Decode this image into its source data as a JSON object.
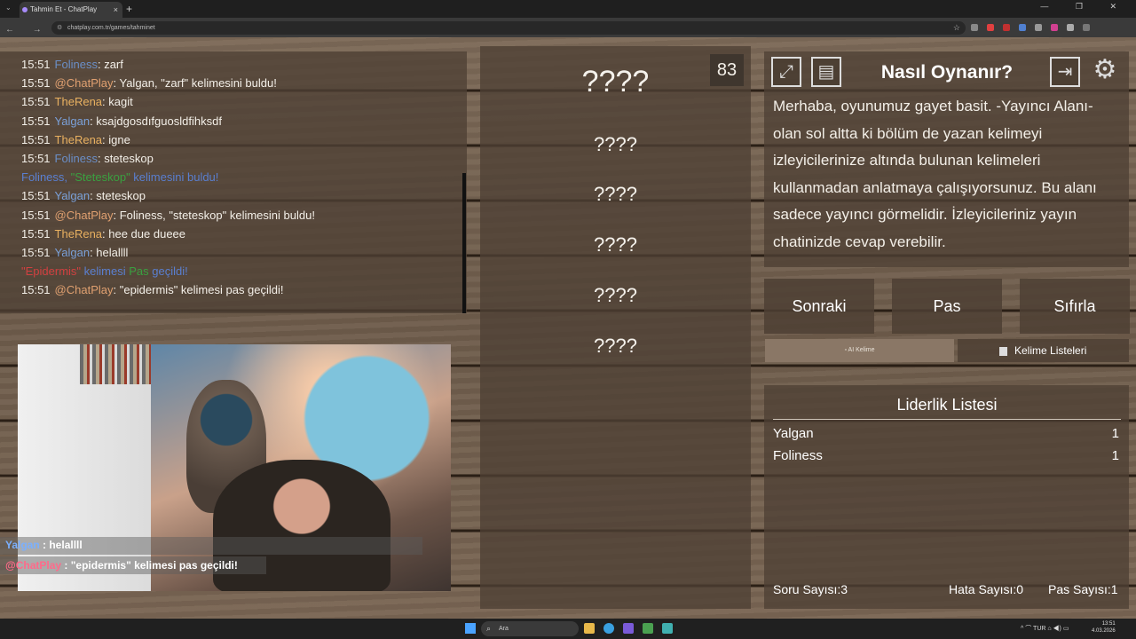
{
  "browser": {
    "tab_title": "Tahmin Et - ChatPlay",
    "tab_close": "×",
    "new_tab": "+",
    "url": "chatplay.com.tr/games/tahminet",
    "nav": "← → ⟳ ⓘ",
    "window_controls": "— ❐ ✕"
  },
  "chat": {
    "messages": [
      {
        "time": "15:51",
        "user": "Foliness",
        "user_color": "#6b8fc7",
        "text": ": zarf"
      },
      {
        "time": "15:51",
        "user": "@ChatPlay",
        "user_color": "#e0a070",
        "text": ": Yalgan, \"zarf\" kelimesini buldu!"
      },
      {
        "time": "15:51",
        "user": "TheRena",
        "user_color": "#e8b060",
        "text": ": kagit"
      },
      {
        "time": "15:51",
        "user": "Yalgan",
        "user_color": "#7aa0d8",
        "text": ": ksajdgosdıfguosldfihksdf"
      },
      {
        "time": "15:51",
        "user": "TheRena",
        "user_color": "#e8b060",
        "text": ": igne"
      },
      {
        "time": "15:51",
        "user": "Foliness",
        "user_color": "#6b8fc7",
        "text": ": steteskop"
      },
      {
        "time": "",
        "user": "Foliness, ",
        "user_color": "#5a7fd0",
        "text": ""
      },
      {
        "time": "15:51",
        "user": "Yalgan",
        "user_color": "#7aa0d8",
        "text": ": steteskop"
      },
      {
        "time": "15:51",
        "user": "@ChatPlay",
        "user_color": "#e0a070",
        "text": ": Foliness, \"steteskop\" kelimesini buldu!"
      },
      {
        "time": "15:51",
        "user": "TheRena",
        "user_color": "#e8b060",
        "text": ": hee due dueee"
      },
      {
        "time": "15:51",
        "user": "Yalgan",
        "user_color": "#7aa0d8",
        "text": ": helallll"
      },
      {
        "time": "",
        "user": "",
        "user_color": "#d04040",
        "text": ""
      },
      {
        "time": "15:51",
        "user": "@ChatPlay",
        "user_color": "#e0a070",
        "text": ": \"epidermis\" kelimesi pas geçildi!"
      }
    ],
    "found_line": {
      "who": "Foliness, ",
      "word": "\"Steteskop\"",
      "rest": " kelimesini buldu!"
    },
    "pass_line": {
      "word": "\"Epidermis\"",
      "mid": " kelimesi ",
      "pas": "Pas",
      "rest": " geçildi!"
    }
  },
  "webcam_overlay": {
    "line1_user": "Yalgan",
    "line1_text": " : helallll",
    "line2_user": "@ChatPlay",
    "line2_text": " : \"epidermis\" kelimesi pas geçildi!"
  },
  "game": {
    "timer": "83",
    "words": [
      "????",
      "????",
      "????",
      "????",
      "????",
      "????"
    ]
  },
  "howto": {
    "title": "Nasıl Oynanır?",
    "text": "Merhaba, oyunumuz gayet basit. -Yayıncı Alanı- olan sol altta ki bölüm de yazan kelimeyi izleyicilerinize altında bulunan kelimeleri kullanmadan anlatmaya çalışıyorsunuz. Bu alanı sadece yayıncı görmelidir. İzleyicileriniz yayın chatinizde cevap verebilir.",
    "icons": {
      "fullscreen": "fullscreen-icon",
      "list": "list-icon",
      "exit": "exit-icon",
      "settings": "gear-icon"
    }
  },
  "buttons": {
    "next": "Sonraki",
    "pass": "Pas",
    "reset": "Sıfırla",
    "ai_word": "AI Kelime",
    "word_lists": "Kelime Listeleri"
  },
  "leaderboard": {
    "title": "Liderlik Listesi",
    "rows": [
      {
        "name": "Yalgan",
        "score": "1"
      },
      {
        "name": "Foliness",
        "score": "1"
      }
    ],
    "question_count": "Soru Sayısı:3",
    "error_count": "Hata Sayısı:0",
    "pass_count": "Pas Sayısı:1"
  },
  "taskbar": {
    "search_placeholder": "Ara",
    "tray": "^   ⌒  TUR  ⌂  ◀)  ▭",
    "time": "13:51",
    "date": "4.03.2026"
  },
  "colors": {
    "found_word": "#3aa040",
    "found_rest": "#5a7fd0",
    "pass_word": "#d04040",
    "pass_mid": "#5a7fd0",
    "pass_pas": "#3aa040"
  }
}
